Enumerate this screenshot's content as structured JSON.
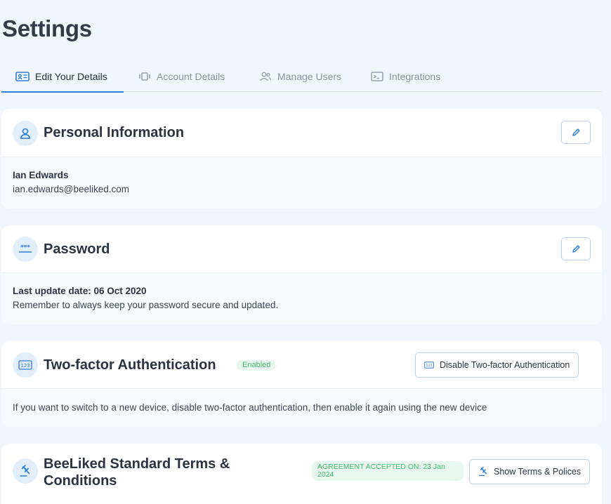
{
  "page": {
    "title": "Settings"
  },
  "tabs": [
    {
      "label": "Edit Your Details",
      "icon": "id-card-icon",
      "active": true
    },
    {
      "label": "Account Details",
      "icon": "device-icon",
      "active": false
    },
    {
      "label": "Manage Users",
      "icon": "users-icon",
      "active": false
    },
    {
      "label": "Integrations",
      "icon": "terminal-icon",
      "active": false
    }
  ],
  "personal": {
    "title": "Personal Information",
    "name": "Ian Edwards",
    "email": "ian.edwards@beeliked.com",
    "icon": "user-icon"
  },
  "password": {
    "title": "Password",
    "last_update": "Last update date: 06 Oct 2020",
    "note": "Remember to always keep your password secure and updated.",
    "icon": "password-dots-icon"
  },
  "twofa": {
    "title": "Two-factor Authentication",
    "status": "Enabled",
    "button_label": "Disable Two-factor Authentication",
    "note": "If you want to switch to a new device, disable two-factor authentication, then enable it again using the new device",
    "icon": "numeric-123-icon"
  },
  "terms": {
    "title_line1": "BeeLiked Standard Terms &",
    "title_line2": "Conditions",
    "badge_line1": "AGREEMENT ACCEPTED ON: 23 Jan",
    "badge_line2": "2024",
    "button_label": "Show Terms & Polices",
    "icon": "gavel-icon"
  },
  "colors": {
    "accent": "#2f7fd8",
    "background": "#f1f6fc",
    "success": "#3fbf6a"
  }
}
